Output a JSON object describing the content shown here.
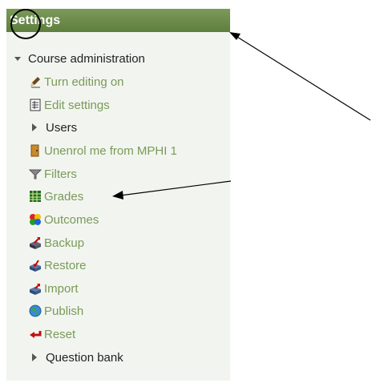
{
  "block": {
    "title": "Settings",
    "root": "Course administration",
    "items": [
      {
        "label": "Turn editing on",
        "icon": "pencil-icon"
      },
      {
        "label": "Edit settings",
        "icon": "document-icon"
      },
      {
        "label": "Users",
        "icon": "triangle-right-icon"
      },
      {
        "label": "Unenrol me from MPHI 1",
        "icon": "door-icon"
      },
      {
        "label": "Filters",
        "icon": "funnel-icon"
      },
      {
        "label": "Grades",
        "icon": "grades-table-icon"
      },
      {
        "label": "Outcomes",
        "icon": "outcomes-icon"
      },
      {
        "label": "Backup",
        "icon": "backup-icon"
      },
      {
        "label": "Restore",
        "icon": "restore-icon"
      },
      {
        "label": "Import",
        "icon": "import-icon"
      },
      {
        "label": "Publish",
        "icon": "globe-icon"
      },
      {
        "label": "Reset",
        "icon": "reset-arrow-icon"
      },
      {
        "label": "Question bank",
        "icon": "triangle-right-icon"
      }
    ]
  },
  "colors": {
    "header_bg": "#6b8a4b",
    "panel_bg": "#f2f5ef",
    "link": "#7a9a5a",
    "text": "#222222"
  }
}
